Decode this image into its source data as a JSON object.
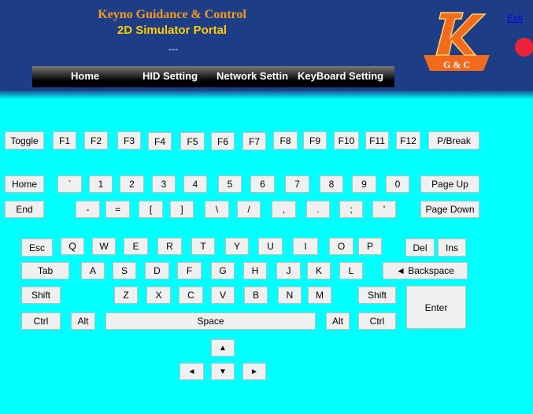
{
  "header": {
    "title": "Keyno Guidance & Control",
    "subtitle": "2D Simulator Portal",
    "separator": "---",
    "exit_label": "Exit",
    "logo_letter": "K",
    "logo_text": "G & C",
    "colors": {
      "header_bg": "#1d3e86",
      "page_bg": "#00ffff",
      "title": "#f89a1e",
      "subtitle": "#ffcc00",
      "logo": "#f26b1d"
    }
  },
  "nav": [
    {
      "label": "Home"
    },
    {
      "label": "HID Setting"
    },
    {
      "label": "Network Settin"
    },
    {
      "label": "KeyBoard Setting"
    }
  ],
  "keys": {
    "toggle": "Toggle",
    "f1": "F1",
    "f2": "F2",
    "f3": "F3",
    "f4": "F4",
    "f5": "F5",
    "f6": "F6",
    "f7": "F7",
    "f8": "F8",
    "f9": "F9",
    "f10": "F10",
    "f11": "F11",
    "f12": "F12",
    "pause_break": "P/Break",
    "home": "Home",
    "backtick": "`",
    "d1": "1",
    "d2": "2",
    "d3": "3",
    "d4": "4",
    "d5": "5",
    "d6": "6",
    "d7": "7",
    "d8": "8",
    "d9": "9",
    "d0": "0",
    "page_up": "Page Up",
    "end": "End",
    "minus": "-",
    "equals": "=",
    "lbracket": "[",
    "rbracket": "]",
    "backslash": "\\",
    "slash": "/",
    "comma": ",",
    "period": ".",
    "semicolon": ";",
    "quote": "'",
    "page_down": "Page Down",
    "esc": "Esc",
    "q": "Q",
    "w": "W",
    "e": "E",
    "r": "R",
    "t": "T",
    "y": "Y",
    "u": "U",
    "i": "I",
    "o": "O",
    "p": "P",
    "del": "Del",
    "ins": "Ins",
    "tab": "Tab",
    "a": "A",
    "s": "S",
    "d": "D",
    "f": "F",
    "g": "G",
    "h": "H",
    "j": "J",
    "k": "K",
    "l": "L",
    "backspace": "◄ Backspace",
    "shift_left": "Shift",
    "z": "Z",
    "x": "X",
    "c": "C",
    "v": "V",
    "b": "B",
    "n": "N",
    "m": "M",
    "shift_right": "Shift",
    "enter": "Enter",
    "ctrl_left": "Ctrl",
    "alt_left": "Alt",
    "space": "Space",
    "alt_right": "Alt",
    "ctrl_right": "Ctrl",
    "arrow_up": "▲",
    "arrow_left": "◄",
    "arrow_down": "▼",
    "arrow_right": "►"
  }
}
